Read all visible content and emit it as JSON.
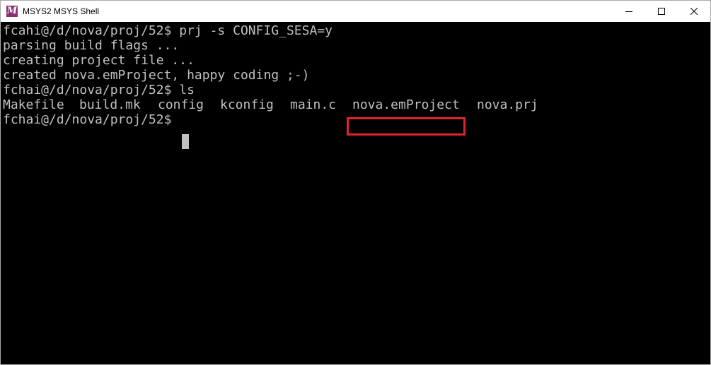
{
  "window": {
    "title": "MSYS2 MSYS Shell",
    "app_icon_glyph": "M",
    "app_icon_color": "#8b2f74",
    "icons": [
      "msys2-logo-icon",
      "minimize-icon",
      "maximize-icon",
      "close-icon"
    ]
  },
  "terminal": {
    "background": "#000000",
    "foreground": "#c0c0c0",
    "lines": [
      "fcahi@/d/nova/proj/52$ prj -s CONFIG_SESA=y",
      "parsing build flags ...",
      "creating project file ...",
      "created nova.emProject, happy coding ;-)",
      "fchai@/d/nova/proj/52$ ls"
    ],
    "ls_output": [
      "Makefile",
      "build.mk",
      "config",
      "kconfig",
      "main.c",
      "nova.emProject",
      "nova.prj"
    ],
    "prompt": "fchai@/d/nova/proj/52$",
    "highlight_color": "#e0242b",
    "highlighted_item": "nova.emProject"
  }
}
